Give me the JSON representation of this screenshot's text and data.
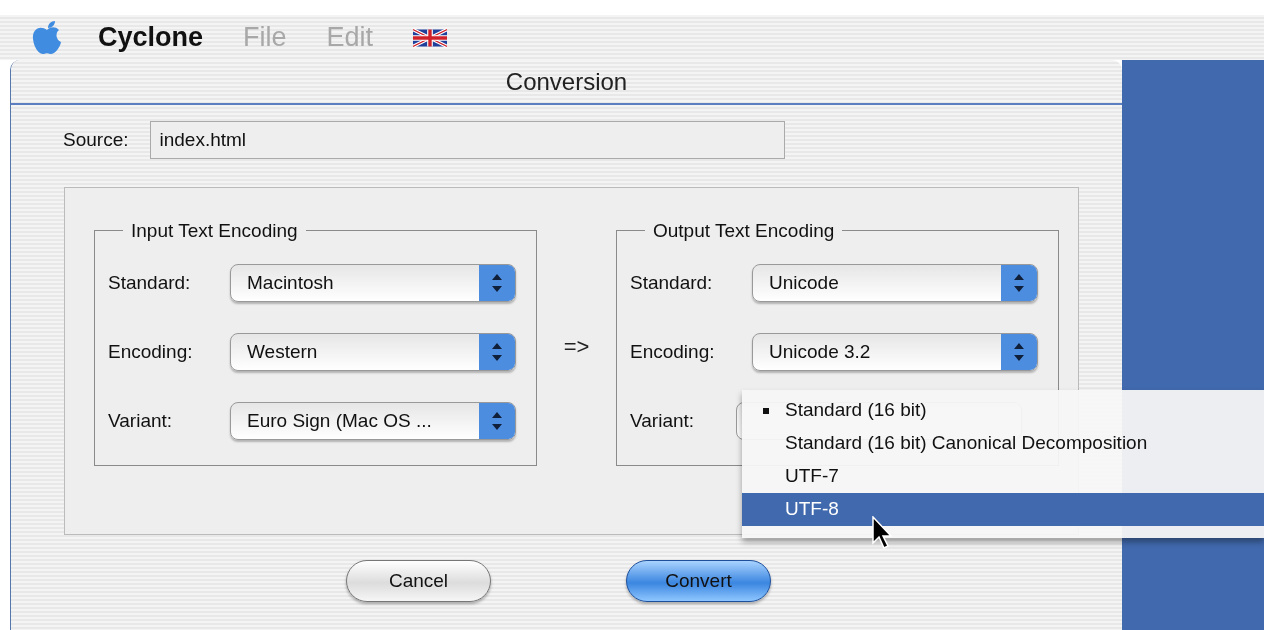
{
  "menubar": {
    "app_name": "Cyclone",
    "menus": [
      {
        "label": "File",
        "disabled": true
      },
      {
        "label": "Edit",
        "disabled": true
      }
    ]
  },
  "window": {
    "title": "Conversion"
  },
  "source": {
    "label": "Source:",
    "value": "index.html"
  },
  "input_group": {
    "title": "Input Text Encoding",
    "rows": [
      {
        "label": "Standard:",
        "value": "Macintosh"
      },
      {
        "label": "Encoding:",
        "value": "Western"
      },
      {
        "label": "Variant:",
        "value": "Euro Sign (Mac OS ..."
      }
    ]
  },
  "arrow": "=>",
  "output_group": {
    "title": "Output Text Encoding",
    "rows": [
      {
        "label": "Standard:",
        "value": "Unicode"
      },
      {
        "label": "Encoding:",
        "value": "Unicode 3.2"
      },
      {
        "label": "Variant:"
      }
    ]
  },
  "variant_menu": {
    "items": [
      {
        "label": "Standard (16 bit)",
        "checked": true,
        "selected": false
      },
      {
        "label": "Standard (16 bit) Canonical Decomposition",
        "checked": false,
        "selected": false
      },
      {
        "label": "UTF-7",
        "checked": false,
        "selected": false
      },
      {
        "label": "UTF-8",
        "checked": false,
        "selected": true
      }
    ]
  },
  "buttons": [
    {
      "label": "Cancel",
      "default": false
    },
    {
      "label": "Convert",
      "default": true
    }
  ]
}
